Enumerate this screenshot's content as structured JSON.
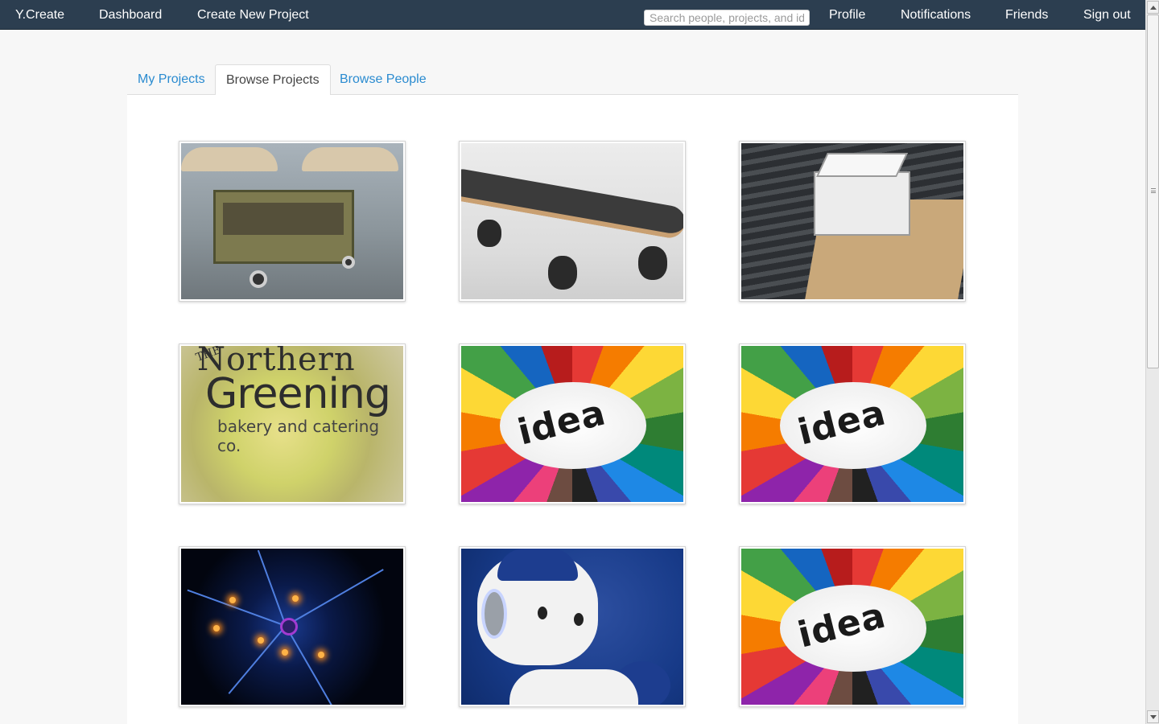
{
  "nav": {
    "brand": "Y.Create",
    "dashboard": "Dashboard",
    "create_project": "Create New Project",
    "search_placeholder": "Search people, projects, and ideas",
    "profile": "Profile",
    "notifications": "Notifications",
    "friends": "Friends",
    "sign_out": "Sign out"
  },
  "tabs": {
    "my_projects": "My Projects",
    "browse_projects": "Browse Projects",
    "browse_people": "Browse People",
    "active": "Browse Projects"
  },
  "projects": [
    {
      "image": "food-cart"
    },
    {
      "image": "skateboard"
    },
    {
      "image": "house-model"
    },
    {
      "image": "northern-greening-logo",
      "logo_text": [
        "THE",
        "Northern",
        "Greening",
        "bakery and catering co."
      ]
    },
    {
      "image": "idea-pencils",
      "image_text": "idea"
    },
    {
      "image": "idea-pencils",
      "image_text": "idea"
    },
    {
      "image": "neuron"
    },
    {
      "image": "robot"
    },
    {
      "image": "idea-pencils",
      "image_text": "idea"
    }
  ],
  "colors": {
    "navbar": "#2c3e50",
    "link": "#2a8bd0",
    "page_bg": "#f7f7f7"
  }
}
